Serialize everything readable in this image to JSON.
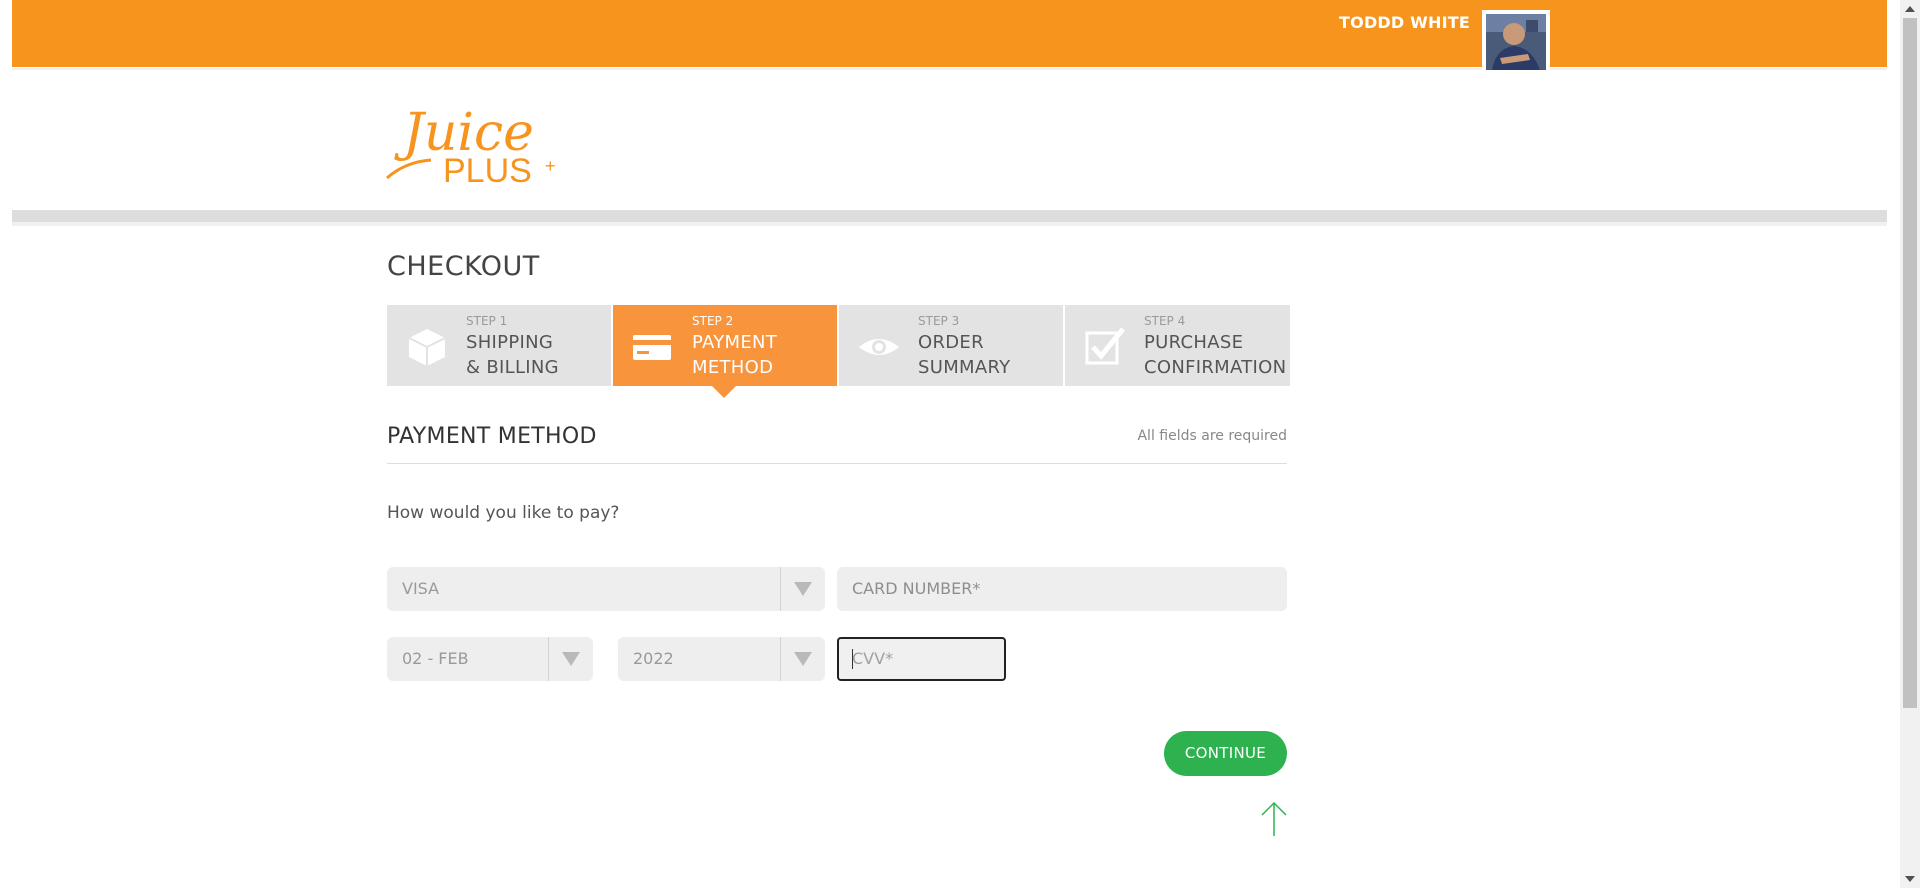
{
  "header": {
    "user_name": "TODDD WHITE",
    "brand_color": "#f7941e",
    "avatar_icon": "user-photo"
  },
  "logo": {
    "line1": "Juice",
    "line2": "PLUS",
    "plus_mark": "+"
  },
  "checkout": {
    "title": "CHECKOUT",
    "steps": [
      {
        "number": "STEP 1",
        "line1": "SHIPPING",
        "line2": "& BILLING",
        "icon": "box-icon",
        "active": false
      },
      {
        "number": "STEP 2",
        "line1": "PAYMENT",
        "line2": "METHOD",
        "icon": "credit-card-icon",
        "active": true
      },
      {
        "number": "STEP 3",
        "line1": "ORDER",
        "line2": "SUMMARY",
        "icon": "eye-icon",
        "active": false
      },
      {
        "number": "STEP 4",
        "line1": "PURCHASE",
        "line2": "CONFIRMATION",
        "icon": "checkbox-icon",
        "active": false
      }
    ]
  },
  "payment": {
    "section_title": "PAYMENT METHOD",
    "required_note": "All fields are required",
    "question": "How would you like to pay?",
    "card_type": "VISA",
    "card_number_placeholder": "CARD NUMBER*",
    "exp_month": "02 - FEB",
    "exp_year": "2022",
    "cvv_placeholder": "CVV*",
    "continue_label": "CONTINUE"
  },
  "colors": {
    "accent": "#f7943c",
    "continue": "#2db24f",
    "back_to_top": "#2db24f"
  }
}
